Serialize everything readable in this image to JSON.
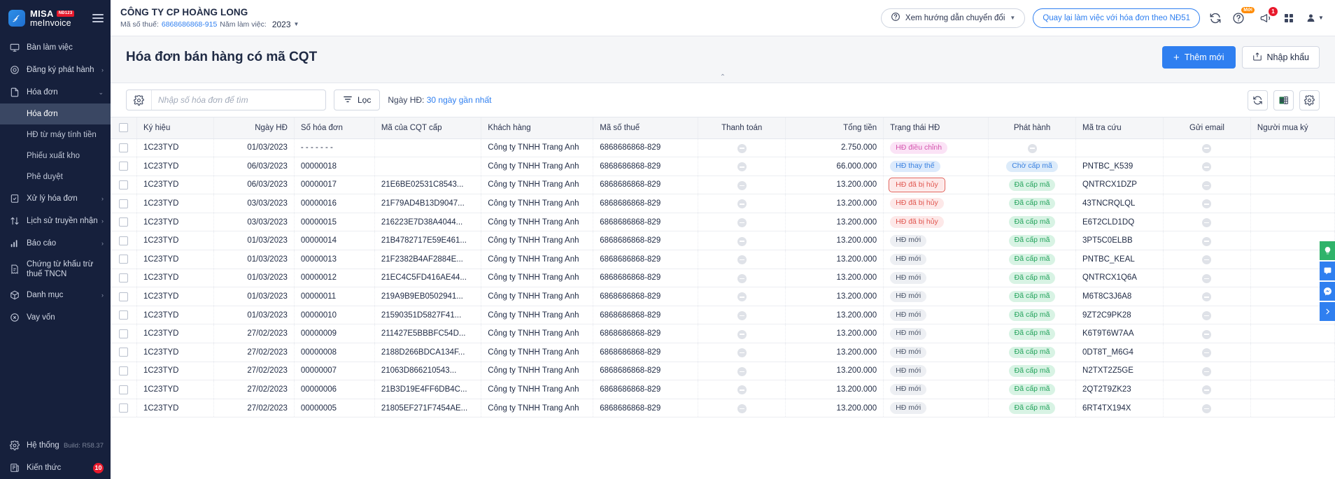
{
  "brand": {
    "name": "MISA",
    "badge": "NĐ123",
    "product": "meInvoice"
  },
  "sidebar": {
    "items": [
      {
        "label": "Bàn làm việc",
        "icon": "monitor-icon",
        "chevron": ""
      },
      {
        "label": "Đăng ký phát hành",
        "icon": "stamp-icon",
        "chevron": "›"
      },
      {
        "label": "Hóa đơn",
        "icon": "document-icon",
        "chevron": "⌄"
      }
    ],
    "sub_items": [
      {
        "label": "Hóa đơn",
        "active": true
      },
      {
        "label": "HĐ từ máy tính tiền",
        "active": false
      },
      {
        "label": "Phiếu xuất kho",
        "active": false
      },
      {
        "label": "Phê duyệt",
        "active": false
      }
    ],
    "items2": [
      {
        "label": "Xử lý hóa đơn",
        "icon": "doc-check-icon",
        "chevron": "›"
      },
      {
        "label": "Lịch sử truyền nhận",
        "icon": "transfer-icon",
        "chevron": "›"
      },
      {
        "label": "Báo cáo",
        "icon": "chart-bar-icon",
        "chevron": "›"
      },
      {
        "label": "Chứng từ khấu trừ thuế TNCN",
        "icon": "receipt-icon",
        "chevron": ""
      },
      {
        "label": "Danh mục",
        "icon": "box-icon",
        "chevron": "›"
      },
      {
        "label": "Vay vốn",
        "icon": "loan-icon",
        "chevron": ""
      }
    ],
    "bottom": [
      {
        "label": "Hệ thống",
        "icon": "gear-icon",
        "meta": "Build: R58.37",
        "badge": ""
      },
      {
        "label": "Kiến thức",
        "icon": "book-icon",
        "meta": "",
        "badge": "10"
      }
    ]
  },
  "topbar": {
    "org_name": "CÔNG TY CP HOÀNG LONG",
    "tax_label": "Mã số thuế:",
    "tax_value": "6868686868-915",
    "year_label": "Năm làm việc:",
    "year_value": "2023",
    "guide_button": "Xem hướng dẫn chuyển đổi",
    "back_button": "Quay lại làm việc với hóa đơn theo NĐ51",
    "help_badge": "Mới",
    "notification_count": "1"
  },
  "page": {
    "title": "Hóa đơn bán hàng có mã CQT",
    "add_button": "Thêm mới",
    "import_button": "Nhập khẩu"
  },
  "filters": {
    "search_placeholder": "Nhập số hóa đơn để tìm",
    "search_value": "",
    "filter_button": "Lọc",
    "date_label": "Ngày HĐ:",
    "date_value": "30 ngày gần nhất"
  },
  "table": {
    "columns": [
      "Ký hiệu",
      "Ngày HĐ",
      "Số hóa đơn",
      "Mã của CQT cấp",
      "Khách hàng",
      "Mã số thuế",
      "Thanh toán",
      "Tổng tiền",
      "Trạng thái HĐ",
      "Phát hành",
      "Mã tra cứu",
      "Gửi email",
      "Người mua ký"
    ],
    "rows": [
      {
        "ky_hieu": "1C23TYD",
        "ngay": "01/03/2023",
        "so": "- - - - - - -",
        "cqt": "",
        "khach": "Công ty TNHH Trang Anh",
        "mst": "6868686868-829",
        "thanh_toan": "minus",
        "tong": "2.750.000",
        "trang_thai": "HĐ điều chỉnh",
        "tt_style": "tag-pink",
        "tt_outline": false,
        "phat_hanh": "minus",
        "ph_style": "",
        "tra_cuu": "",
        "email": "minus",
        "mua_ky": ""
      },
      {
        "ky_hieu": "1C23TYD",
        "ngay": "06/03/2023",
        "so": "00000018",
        "cqt": "",
        "khach": "Công ty TNHH Trang Anh",
        "mst": "6868686868-829",
        "thanh_toan": "minus",
        "tong": "66.000.000",
        "trang_thai": "HĐ thay thế",
        "tt_style": "tag-blue",
        "tt_outline": false,
        "phat_hanh": "Chờ cấp mã",
        "ph_style": "tag-lblue",
        "tra_cuu": "PNTBC_K539",
        "email": "minus",
        "mua_ky": ""
      },
      {
        "ky_hieu": "1C23TYD",
        "ngay": "06/03/2023",
        "so": "00000017",
        "cqt": "21E6BE02531C8543...",
        "khach": "Công ty TNHH Trang Anh",
        "mst": "6868686868-829",
        "thanh_toan": "minus",
        "tong": "13.200.000",
        "trang_thai": "HĐ đã bị hủy",
        "tt_style": "tag-red",
        "tt_outline": true,
        "phat_hanh": "Đã cấp mã",
        "ph_style": "tag-green",
        "tra_cuu": "QNTRCX1DZP",
        "email": "minus",
        "mua_ky": ""
      },
      {
        "ky_hieu": "1C23TYD",
        "ngay": "03/03/2023",
        "so": "00000016",
        "cqt": "21F79AD4B13D9047...",
        "khach": "Công ty TNHH Trang Anh",
        "mst": "6868686868-829",
        "thanh_toan": "minus",
        "tong": "13.200.000",
        "trang_thai": "HĐ đã bị hủy",
        "tt_style": "tag-red",
        "tt_outline": false,
        "phat_hanh": "Đã cấp mã",
        "ph_style": "tag-green",
        "tra_cuu": "43TNCRQLQL",
        "email": "minus",
        "mua_ky": ""
      },
      {
        "ky_hieu": "1C23TYD",
        "ngay": "03/03/2023",
        "so": "00000015",
        "cqt": "216223E7D38A4044...",
        "khach": "Công ty TNHH Trang Anh",
        "mst": "6868686868-829",
        "thanh_toan": "minus",
        "tong": "13.200.000",
        "trang_thai": "HĐ đã bị hủy",
        "tt_style": "tag-red",
        "tt_outline": false,
        "phat_hanh": "Đã cấp mã",
        "ph_style": "tag-green",
        "tra_cuu": "E6T2CLD1DQ",
        "email": "minus",
        "mua_ky": ""
      },
      {
        "ky_hieu": "1C23TYD",
        "ngay": "01/03/2023",
        "so": "00000014",
        "cqt": "21B4782717E59E461...",
        "khach": "Công ty TNHH Trang Anh",
        "mst": "6868686868-829",
        "thanh_toan": "minus",
        "tong": "13.200.000",
        "trang_thai": "HĐ mới",
        "tt_style": "tag-grey",
        "tt_outline": false,
        "phat_hanh": "Đã cấp mã",
        "ph_style": "tag-green",
        "tra_cuu": "3PT5C0ELBB",
        "email": "minus",
        "mua_ky": ""
      },
      {
        "ky_hieu": "1C23TYD",
        "ngay": "01/03/2023",
        "so": "00000013",
        "cqt": "21F2382B4AF2884E...",
        "khach": "Công ty TNHH Trang Anh",
        "mst": "6868686868-829",
        "thanh_toan": "minus",
        "tong": "13.200.000",
        "trang_thai": "HĐ mới",
        "tt_style": "tag-grey",
        "tt_outline": false,
        "phat_hanh": "Đã cấp mã",
        "ph_style": "tag-green",
        "tra_cuu": "PNTBC_KEAL",
        "email": "minus",
        "mua_ky": ""
      },
      {
        "ky_hieu": "1C23TYD",
        "ngay": "01/03/2023",
        "so": "00000012",
        "cqt": "21EC4C5FD416AE44...",
        "khach": "Công ty TNHH Trang Anh",
        "mst": "6868686868-829",
        "thanh_toan": "minus",
        "tong": "13.200.000",
        "trang_thai": "HĐ mới",
        "tt_style": "tag-grey",
        "tt_outline": false,
        "phat_hanh": "Đã cấp mã",
        "ph_style": "tag-green",
        "tra_cuu": "QNTRCX1Q6A",
        "email": "minus",
        "mua_ky": ""
      },
      {
        "ky_hieu": "1C23TYD",
        "ngay": "01/03/2023",
        "so": "00000011",
        "cqt": "219A9B9EB0502941...",
        "khach": "Công ty TNHH Trang Anh",
        "mst": "6868686868-829",
        "thanh_toan": "minus",
        "tong": "13.200.000",
        "trang_thai": "HĐ mới",
        "tt_style": "tag-grey",
        "tt_outline": false,
        "phat_hanh": "Đã cấp mã",
        "ph_style": "tag-green",
        "tra_cuu": "M6T8C3J6A8",
        "email": "minus",
        "mua_ky": ""
      },
      {
        "ky_hieu": "1C23TYD",
        "ngay": "01/03/2023",
        "so": "00000010",
        "cqt": "21590351D5827F41...",
        "khach": "Công ty TNHH Trang Anh",
        "mst": "6868686868-829",
        "thanh_toan": "minus",
        "tong": "13.200.000",
        "trang_thai": "HĐ mới",
        "tt_style": "tag-grey",
        "tt_outline": false,
        "phat_hanh": "Đã cấp mã",
        "ph_style": "tag-green",
        "tra_cuu": "9ZT2C9PK28",
        "email": "minus",
        "mua_ky": ""
      },
      {
        "ky_hieu": "1C23TYD",
        "ngay": "27/02/2023",
        "so": "00000009",
        "cqt": "211427E5BBBFC54D...",
        "khach": "Công ty TNHH Trang Anh",
        "mst": "6868686868-829",
        "thanh_toan": "minus",
        "tong": "13.200.000",
        "trang_thai": "HĐ mới",
        "tt_style": "tag-grey",
        "tt_outline": false,
        "phat_hanh": "Đã cấp mã",
        "ph_style": "tag-green",
        "tra_cuu": "K6T9T6W7AA",
        "email": "minus",
        "mua_ky": ""
      },
      {
        "ky_hieu": "1C23TYD",
        "ngay": "27/02/2023",
        "so": "00000008",
        "cqt": "2188D266BDCA134F...",
        "khach": "Công ty TNHH Trang Anh",
        "mst": "6868686868-829",
        "thanh_toan": "minus",
        "tong": "13.200.000",
        "trang_thai": "HĐ mới",
        "tt_style": "tag-grey",
        "tt_outline": false,
        "phat_hanh": "Đã cấp mã",
        "ph_style": "tag-green",
        "tra_cuu": "0DT8T_M6G4",
        "email": "minus",
        "mua_ky": ""
      },
      {
        "ky_hieu": "1C23TYD",
        "ngay": "27/02/2023",
        "so": "00000007",
        "cqt": "21063D866210543...",
        "khach": "Công ty TNHH Trang Anh",
        "mst": "6868686868-829",
        "thanh_toan": "minus",
        "tong": "13.200.000",
        "trang_thai": "HĐ mới",
        "tt_style": "tag-grey",
        "tt_outline": false,
        "phat_hanh": "Đã cấp mã",
        "ph_style": "tag-green",
        "tra_cuu": "N2TXT2Z5GE",
        "email": "minus",
        "mua_ky": ""
      },
      {
        "ky_hieu": "1C23TYD",
        "ngay": "27/02/2023",
        "so": "00000006",
        "cqt": "21B3D19E4FF6DB4C...",
        "khach": "Công ty TNHH Trang Anh",
        "mst": "6868686868-829",
        "thanh_toan": "minus",
        "tong": "13.200.000",
        "trang_thai": "HĐ mới",
        "tt_style": "tag-grey",
        "tt_outline": false,
        "phat_hanh": "Đã cấp mã",
        "ph_style": "tag-green",
        "tra_cuu": "2QT2T9ZK23",
        "email": "minus",
        "mua_ky": ""
      },
      {
        "ky_hieu": "1C23TYD",
        "ngay": "27/02/2023",
        "so": "00000005",
        "cqt": "21805EF271F7454AE...",
        "khach": "Công ty TNHH Trang Anh",
        "mst": "6868686868-829",
        "thanh_toan": "minus",
        "tong": "13.200.000",
        "trang_thai": "HĐ mới",
        "tt_style": "tag-grey",
        "tt_outline": false,
        "phat_hanh": "Đã cấp mã",
        "ph_style": "tag-green",
        "tra_cuu": "6RT4TX194X",
        "email": "minus",
        "mua_ky": ""
      }
    ]
  },
  "colors": {
    "accent": "#2f7ff0",
    "sidebar_bg": "#16203c",
    "danger": "#e8192c",
    "success": "#24a35c"
  }
}
